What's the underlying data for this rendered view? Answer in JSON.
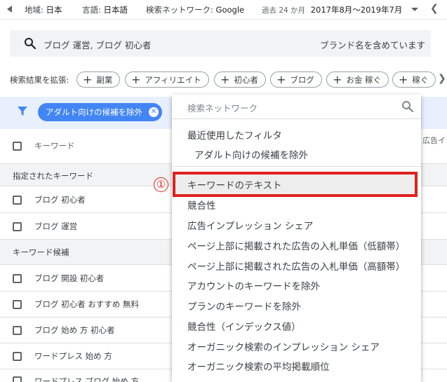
{
  "topbar": {
    "region_label": "地域:",
    "region_value": "日本",
    "language_label": "言語:",
    "language_value": "日本語",
    "network_label": "検索ネットワーク:",
    "network_value": "Google",
    "period_label": "過去 24 か月",
    "period_value": "2017年8月～2019年7月"
  },
  "search": {
    "query": "ブログ 運営, ブログ 初心者",
    "brand_toggle": "ブランド名を含めています"
  },
  "expand": {
    "label": "検索結果を拡張:",
    "chips": [
      "副業",
      "アフィリエイト",
      "初心者",
      "ブログ",
      "お金 稼ぐ",
      "稼ぐ"
    ]
  },
  "filter": {
    "active_filter": "アダルト向けの候補を除外"
  },
  "table": {
    "header_keyword": "キーワード",
    "header_right": "広告イ",
    "section_specified": "指定されたキーワード",
    "specified_rows": [
      "ブログ 初心者",
      "ブログ 運営"
    ],
    "section_candidates": "キーワード候補",
    "candidate_rows": [
      "ブログ 開設 初心者",
      "ブログ 初心者 おすすめ 無料",
      "ブログ 始め 方 初心者",
      "ワードプレス 始め 方",
      "ワードプレス ブログ 始め 方"
    ]
  },
  "dropdown": {
    "search_placeholder": "検索ネットワーク",
    "recent_heading": "最近使用したフィルタ",
    "recent_item": "アダルト向けの候補を除外",
    "options": [
      "キーワードのテキスト",
      "競合性",
      "広告インプレッション シェア",
      "ページ上部に掲載された広告の入札単価（低額帯）",
      "ページ上部に掲載された広告の入札単価（高額帯）",
      "アカウントのキーワードを除外",
      "プランのキーワードを除外",
      "競合性（インデックス値）",
      "オーガニック検索のインプレッション シェア",
      "オーガニック検索の平均掲載順位"
    ]
  },
  "annotation": {
    "marker": "①"
  },
  "colors": {
    "accent_blue": "#4285f4",
    "highlight_red": "#e0201e",
    "filter_row_bg": "#e8f0fe"
  }
}
